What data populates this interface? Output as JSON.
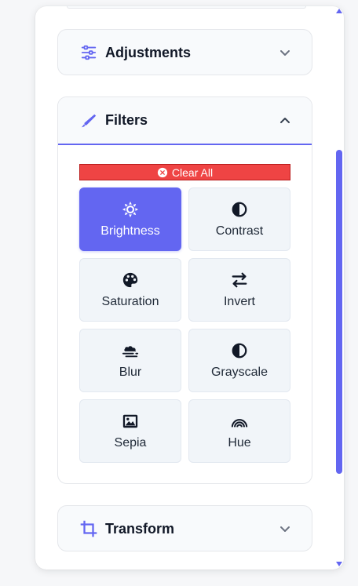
{
  "sections": {
    "adjustments": {
      "title": "Adjustments",
      "icon": "sliders-icon",
      "expanded": false
    },
    "filters": {
      "title": "Filters",
      "icon": "brush-icon",
      "expanded": true
    },
    "transform": {
      "title": "Transform",
      "icon": "crop-icon",
      "expanded": false
    }
  },
  "filters_panel": {
    "clear_all_label": "Clear All",
    "items": [
      {
        "label": "Brightness",
        "icon": "sun-icon",
        "active": true
      },
      {
        "label": "Contrast",
        "icon": "contrast-icon",
        "active": false
      },
      {
        "label": "Saturation",
        "icon": "palette-icon",
        "active": false
      },
      {
        "label": "Invert",
        "icon": "swap-arrows-icon",
        "active": false
      },
      {
        "label": "Blur",
        "icon": "smog-icon",
        "active": false
      },
      {
        "label": "Grayscale",
        "icon": "contrast-icon",
        "active": false
      },
      {
        "label": "Sepia",
        "icon": "image-icon",
        "active": false
      },
      {
        "label": "Hue",
        "icon": "rainbow-icon",
        "active": false
      }
    ]
  },
  "colors": {
    "accent": "#6366f1",
    "danger": "#ef4444",
    "text": "#111827"
  }
}
